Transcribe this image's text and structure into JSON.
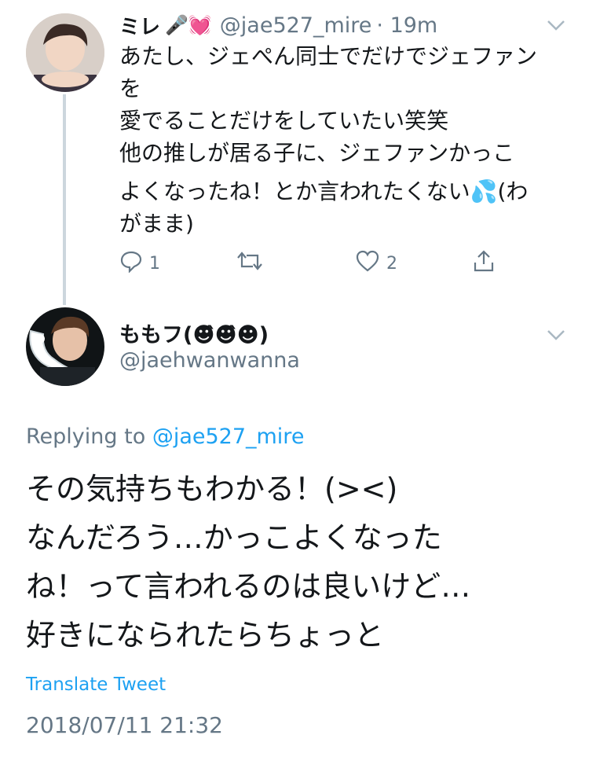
{
  "tweet1": {
    "name": "ミレ",
    "name_emoji": "🎤💓",
    "handle": "@jae527_mire",
    "time": "· 19m",
    "lines": [
      "あたし、ジェぺん同士でだけでジェファン",
      "を",
      "愛でることだけをしていたい笑笑",
      "他の推しが居る子に、ジェファンかっこ",
      "よくなったね！とか言われたくない💦(わ",
      "がまま)"
    ],
    "actions": {
      "reply_count": "1",
      "retweet_count": "",
      "like_count": "2"
    }
  },
  "tweet2": {
    "name": "ももフ(☻̂☻̂☻)",
    "handle": "@jaehwanwanna",
    "replying_prefix": "Replying to",
    "replying_handle": "@jae527_mire",
    "lines": [
      "その気持ちもわかる！(><)",
      "なんだろう…かっこよくなった",
      "ね！って言われるのは良いけど…",
      "好きになられたらちょっと"
    ],
    "translate": "Translate Tweet",
    "timestamp": "2018/07/11 21:32"
  },
  "colors": {
    "link": "#1da1f2",
    "muted": "#657786",
    "thread_line": "#ccd6dd"
  }
}
